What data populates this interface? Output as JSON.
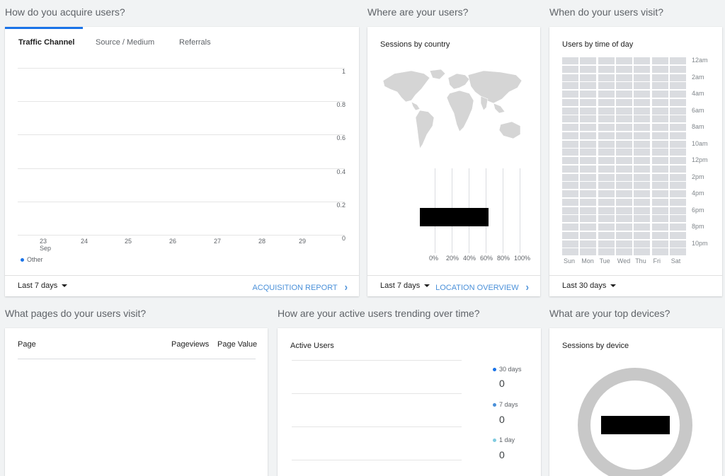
{
  "sections": {
    "acquire": "How do you acquire users?",
    "where": "Where are your users?",
    "when": "When do your users visit?",
    "pages": "What pages do your users visit?",
    "trending": "How are your active users trending over time?",
    "devices": "What are your top devices?"
  },
  "acquire": {
    "tabs": [
      "Traffic Channel",
      "Source / Medium",
      "Referrals"
    ],
    "legend": "Other",
    "footer_range": "Last 7 days",
    "footer_link": "ACQUISITION REPORT"
  },
  "country": {
    "title": "Sessions by country",
    "pct_labels": [
      "0%",
      "20%",
      "40%",
      "60%",
      "80%",
      "100%"
    ],
    "footer_range": "Last 7 days",
    "footer_link": "LOCATION OVERVIEW"
  },
  "time_of_day": {
    "title": "Users by time of day",
    "hours": [
      "12am",
      "2am",
      "4am",
      "6am",
      "8am",
      "10am",
      "12pm",
      "2pm",
      "4pm",
      "6pm",
      "8pm",
      "10pm"
    ],
    "days": [
      "Sun",
      "Mon",
      "Tue",
      "Wed",
      "Thu",
      "Fri",
      "Sat"
    ],
    "footer_range": "Last 30 days"
  },
  "pages": {
    "col_page": "Page",
    "col_pageviews": "Pageviews",
    "col_value": "Page Value"
  },
  "active_users": {
    "title": "Active Users",
    "legend": [
      {
        "label": "30 days",
        "value": "0",
        "color": "#1a73e8"
      },
      {
        "label": "7 days",
        "value": "0",
        "color": "#4a90d9"
      },
      {
        "label": "1 day",
        "value": "0",
        "color": "#80cbe0"
      }
    ]
  },
  "devices": {
    "title": "Sessions by device"
  },
  "colors": {
    "accent": "#1a73e8",
    "link": "#4a90d9",
    "legend_other": "#1a73e8"
  },
  "chart_data": {
    "type": "line",
    "x": [
      "23 Sep",
      "24",
      "25",
      "26",
      "27",
      "28",
      "29"
    ],
    "series": [
      {
        "name": "Other",
        "values": [
          0,
          0,
          0,
          0,
          0,
          0,
          0
        ]
      }
    ],
    "yticks": [
      "1",
      "0.8",
      "0.6",
      "0.4",
      "0.2",
      "0"
    ],
    "ylim": [
      0,
      1
    ],
    "grid": true,
    "legend_position": "bottom-left"
  }
}
